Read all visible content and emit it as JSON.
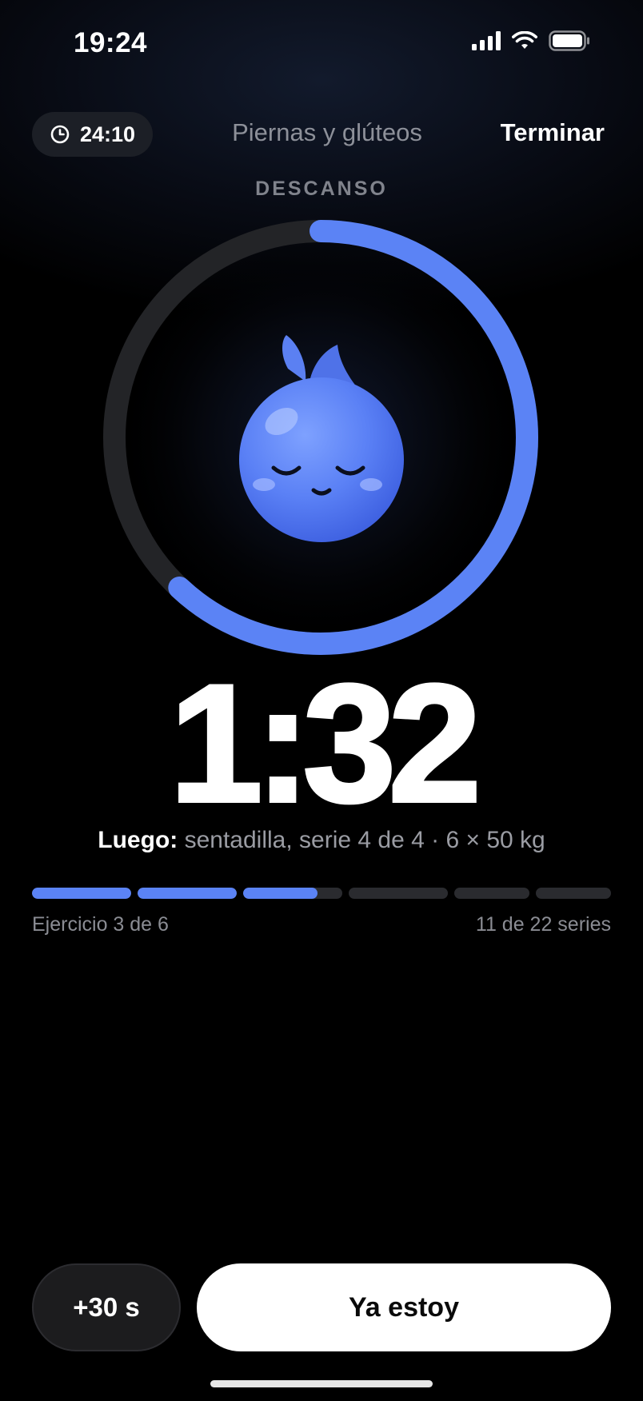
{
  "status_bar": {
    "time": "19:24",
    "icons": [
      "signal-icon",
      "wifi-icon",
      "battery-icon"
    ]
  },
  "header": {
    "elapsed": "24:10",
    "elapsed_icon": "clock-icon",
    "title": "Piernas y glúteos",
    "finish_label": "Terminar"
  },
  "rest": {
    "phase_label": "DESCANSO",
    "countdown": "1:32",
    "ring_progress": 0.62,
    "mascot": "sleeping-blueberry-mascot"
  },
  "next": {
    "key": "Luego:",
    "value": " sentadilla, serie 4 de 4 · 6 × 50 kg"
  },
  "progress": {
    "segments": [
      1,
      1,
      0.75,
      0,
      0,
      0
    ],
    "exercise_label": "Ejercicio 3 de 6",
    "series_label": "11 de 22 series"
  },
  "actions": {
    "add_time_label": "+30 s",
    "ready_label": "Ya estoy"
  },
  "colors": {
    "accent": "#5b83f5",
    "ring_track": "#232427",
    "background": "#000000"
  }
}
